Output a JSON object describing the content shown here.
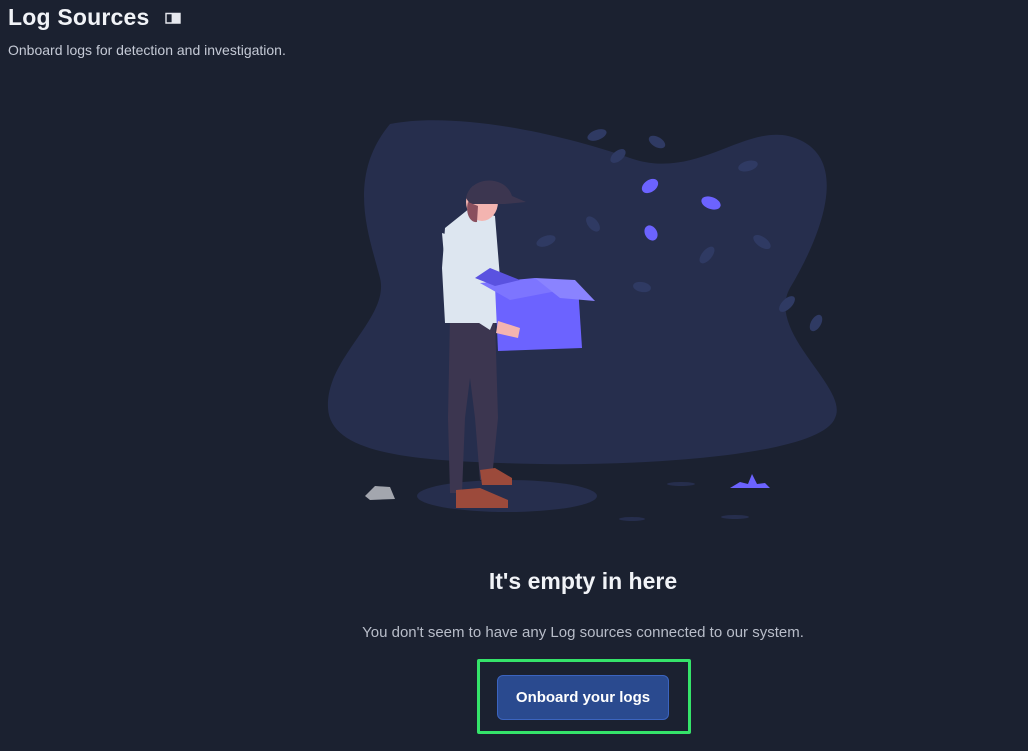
{
  "header": {
    "title": "Log Sources",
    "doc_icon": "book-icon",
    "subtitle": "Onboard logs for detection and investigation."
  },
  "empty_state": {
    "heading": "It's empty in here",
    "message": "You don't seem to have any Log sources connected to our system.",
    "cta_label": "Onboard your logs"
  },
  "colors": {
    "background": "#1b2130",
    "blob": "#262e4d",
    "accent": "#6c63ff",
    "button": "#2a4a8f",
    "highlight": "#35e36a"
  }
}
